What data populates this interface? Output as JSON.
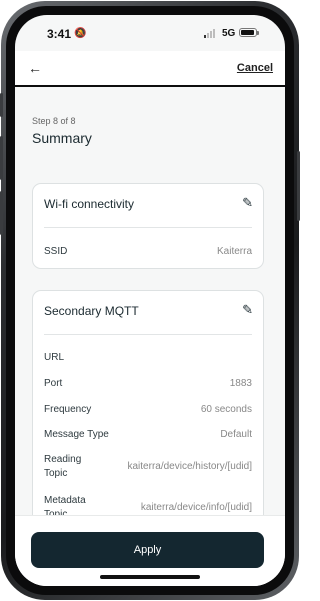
{
  "status_bar": {
    "time": "3:41",
    "network": "5G",
    "battery_fill": 0.95,
    "icons": [
      "bell-slash-icon",
      "signal-icon",
      "battery-icon"
    ]
  },
  "nav": {
    "back_icon": "←",
    "cancel_label": "Cancel"
  },
  "page": {
    "step": "Step 8 of 8",
    "title": "Summary"
  },
  "wifi_card": {
    "title": "Wi-fi connectivity",
    "edit_icon": "✎",
    "rows": [
      {
        "key": "SSID",
        "value": "Kaiterra"
      }
    ]
  },
  "mqtt_card": {
    "title": "Secondary MQTT",
    "edit_icon": "✎",
    "rows": [
      {
        "key": "URL",
        "value": ""
      },
      {
        "key": "Port",
        "value": "1883"
      },
      {
        "key": "Frequency",
        "value": "60 seconds"
      },
      {
        "key": "Message Type",
        "value": "Default"
      },
      {
        "key": "Reading Topic",
        "value": "kaiterra/device/history/[udid]"
      },
      {
        "key": "Metadata Topic",
        "value": "kaiterra/device/info/[udid]"
      }
    ]
  },
  "footer": {
    "apply_label": "Apply"
  },
  "colors": {
    "primary": "#142730",
    "background": "#f6f7f7",
    "card_border": "#dde1e2"
  }
}
